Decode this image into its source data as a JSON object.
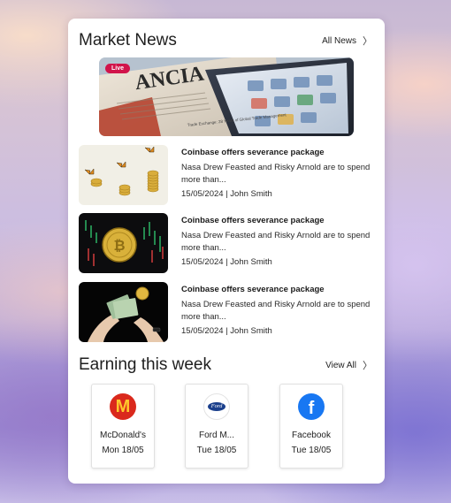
{
  "market_news": {
    "title": "Market News",
    "all_news_label": "All News",
    "hero": {
      "live_label": "Live",
      "headline_fragment": "ANCIA",
      "subheadline": "Trade Exchange: 28 Years of Global Trade Management"
    },
    "items": [
      {
        "title": "Coinbase offers severance package",
        "summary": "Nasa Drew Feasted and Risky Arnold are to spend more than...",
        "date": "15/05/2024",
        "separator": "|",
        "author": "John Smith",
        "thumbnail": "butterflies-coins-image"
      },
      {
        "title": "Coinbase offers severance package",
        "summary": "Nasa Drew Feasted and Risky Arnold are to spend more than...",
        "date": "15/05/2024",
        "separator": "|",
        "author": "John Smith",
        "thumbnail": "bitcoin-chart-image"
      },
      {
        "title": "Coinbase offers severance package",
        "summary": "Nasa Drew Feasted and Risky Arnold are to spend more than...",
        "date": "15/05/2024",
        "separator": "|",
        "author": "John Smith",
        "thumbnail": "hands-coin-cash-image"
      }
    ]
  },
  "earnings": {
    "title": "Earning this week",
    "view_all_label": "View All",
    "items": [
      {
        "name": "McDonald's",
        "date": "Mon 18/05",
        "logo": "mcdonalds-logo",
        "logo_text": "M",
        "color": "#da291c",
        "accent": "#ffc72c"
      },
      {
        "name": "Ford M...",
        "date": "Tue 18/05",
        "logo": "ford-logo",
        "logo_text": "Ford",
        "color": "#1a3f8c",
        "accent": "#ffffff"
      },
      {
        "name": "Facebook",
        "date": "Tue 18/05",
        "logo": "facebook-logo",
        "logo_text": "f",
        "color": "#1877f2",
        "accent": "#ffffff"
      }
    ]
  },
  "colors": {
    "live_badge": "#d1134a",
    "card_bg": "#ffffff"
  }
}
